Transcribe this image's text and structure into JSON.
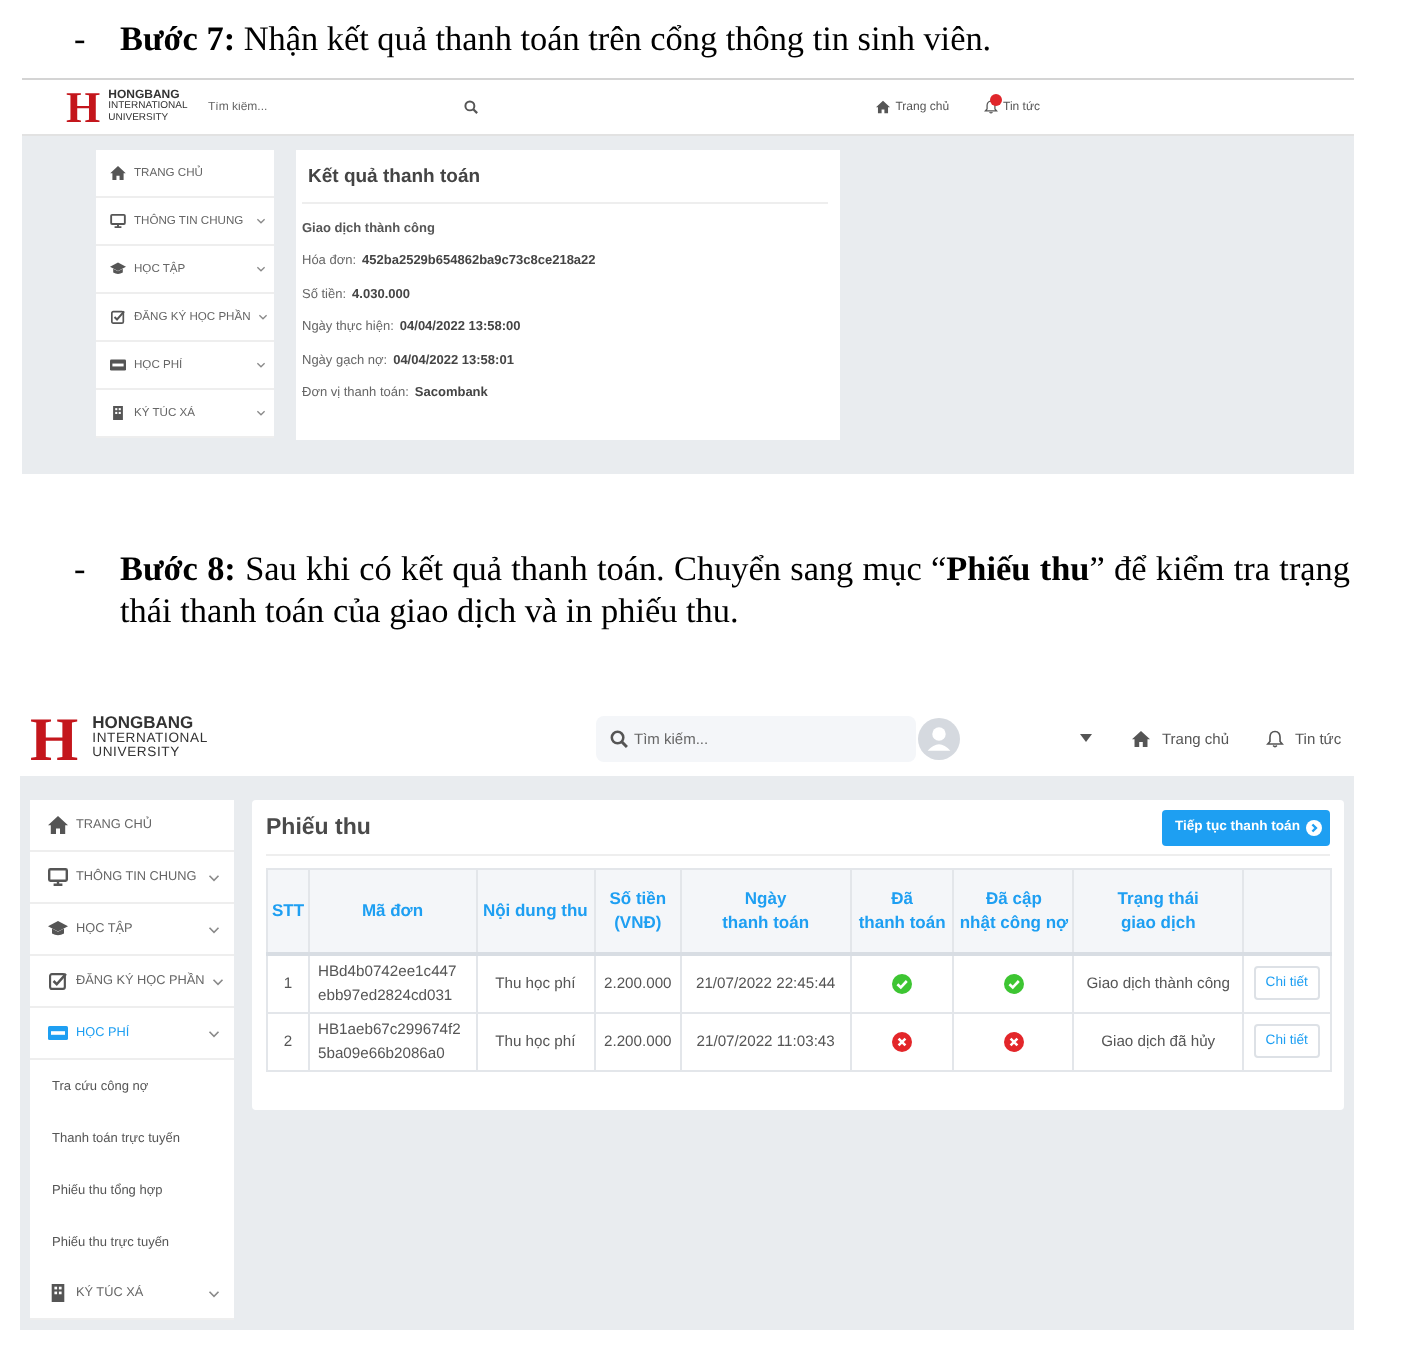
{
  "step_7": {
    "marker": "-",
    "text": "**Bước 7:** Nhận kết quả thanh toán trên cổng thông tin sinh viên."
  },
  "result_screenshot": {
    "logo": {
      "mark": "H",
      "name": "HONGBANG",
      "subtitle_lines": [
        "INTERNATIONAL",
        "UNIVERSITY"
      ]
    },
    "search": {
      "placeholder": "Tìm kiếm..."
    },
    "nav": [
      {
        "label": "Trang chủ",
        "notification": false
      },
      {
        "label": "Tin tức",
        "notification": true
      }
    ],
    "sidebar": {
      "items": [
        {
          "label": "TRANG CHỦ",
          "kind": "link",
          "selected": false
        },
        {
          "label": "THÔNG TIN CHUNG",
          "kind": "group",
          "selected": false
        },
        {
          "label": "HỌC TẬP",
          "kind": "group",
          "selected": false
        },
        {
          "label": "ĐĂNG KÝ HỌC PHẦN",
          "kind": "group",
          "selected": false
        },
        {
          "label": "HỌC PHÍ",
          "kind": "group",
          "selected": false
        },
        {
          "label": "KÝ TÚC XÁ",
          "kind": "group",
          "selected": false
        }
      ]
    },
    "card": {
      "title": "Kết quả thanh toán",
      "status": "Giao dịch thành công",
      "fields": [
        {
          "label": "Hóa đơn:",
          "value": "452ba2529b654862ba9c73c8ce218a22"
        },
        {
          "label": "Số tiền:",
          "value": "4.030.000"
        },
        {
          "label": "Ngày thực hiện:",
          "value": "04/04/2022 13:58:00"
        },
        {
          "label": "Ngày gạch nợ:",
          "value": "04/04/2022 13:58:01"
        },
        {
          "label": "Đơn vị thanh toán:",
          "value": "Sacombank"
        }
      ]
    }
  },
  "step_8": {
    "marker": "-",
    "text": "**Bước 8:** Sau khi có kết quả thanh toán. Chuyển sang mục “**Phiếu thu**” để kiểm tra trạng thái thanh toán của giao dịch và in phiếu thu."
  },
  "receipts_screenshot": {
    "logo": {
      "mark": "H",
      "name": "HONGBANG",
      "subtitle_lines": [
        "INTERNATIONAL",
        "UNIVERSITY"
      ]
    },
    "search": {
      "placeholder": "Tìm kiếm..."
    },
    "nav": [
      {
        "label": "Trang chủ",
        "notification": false
      },
      {
        "label": "Tin tức",
        "notification": false
      }
    ],
    "sidebar": {
      "items": [
        {
          "label": "TRANG CHỦ",
          "kind": "link",
          "selected": false
        },
        {
          "label": "THÔNG TIN CHUNG",
          "kind": "group",
          "selected": false
        },
        {
          "label": "HỌC TẬP",
          "kind": "group",
          "selected": false
        },
        {
          "label": "ĐĂNG KÝ HỌC PHẦN",
          "kind": "group",
          "selected": false
        },
        {
          "label": "HỌC PHÍ",
          "kind": "group",
          "selected": true,
          "children": [
            {
              "label": "Tra cứu công nợ",
              "selected": false
            },
            {
              "label": "Thanh toán trực tuyến",
              "selected": false
            },
            {
              "label": "Phiếu thu tổng hợp",
              "selected": false
            },
            {
              "label": "Phiếu thu trực tuyến",
              "selected": false
            }
          ]
        },
        {
          "label": "KÝ TÚC XÁ",
          "kind": "group",
          "selected": false
        }
      ]
    },
    "card": {
      "title": "Phiếu thu",
      "action": "Tiếp tục thanh toán",
      "table": {
        "columns": [
          "STT",
          "Mã đơn",
          "Nội dung thu",
          "Số tiền\n(VNĐ)",
          "Ngày\nthanh toán",
          "Đã\nthanh toán",
          "Đã cập\nnhật công nợ",
          "Trạng thái\ngiao dịch"
        ],
        "rows": [
          {
            "stt": "1",
            "order_code": "HBd4b0742ee1c447ebb97ed2824cd031",
            "content": "Thu học phí",
            "amount": "2.200.000",
            "paid_at": "21/07/2022 22:45:44",
            "paid": true,
            "debt_updated": true,
            "status": "Giao dịch thành công",
            "action": "Chi tiết"
          },
          {
            "stt": "2",
            "order_code": "HB1aeb67c299674f25ba09e66b2086a0",
            "content": "Thu học phí",
            "amount": "2.200.000",
            "paid_at": "21/07/2022 11:03:43",
            "paid": false,
            "debt_updated": false,
            "status": "Giao dịch đã hủy",
            "action": "Chi tiết"
          }
        ]
      }
    }
  }
}
